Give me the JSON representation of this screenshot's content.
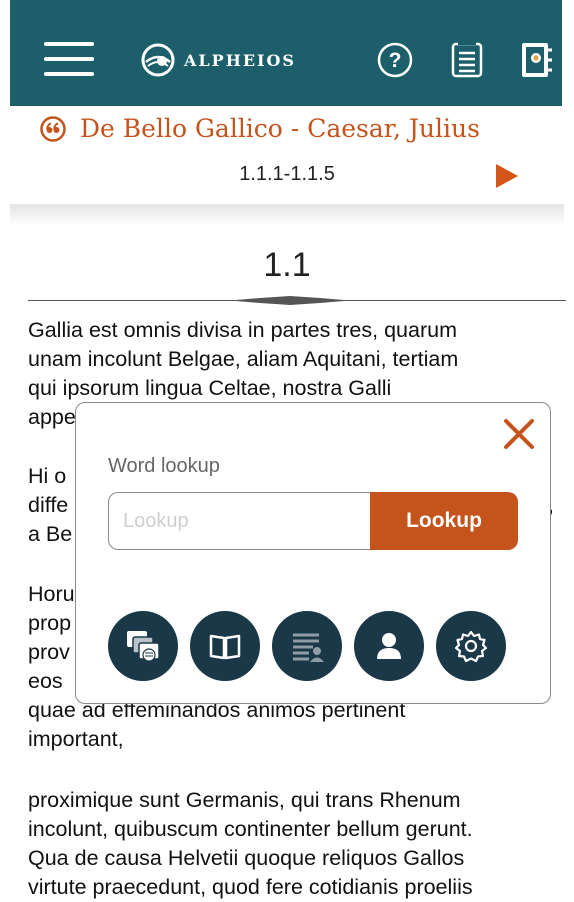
{
  "header": {
    "brand": "ALPHEIOS",
    "icons": [
      "menu-icon",
      "alpheios-logo",
      "help-icon",
      "list-icon",
      "notebook-icon"
    ]
  },
  "document": {
    "title": "De Bello Gallico - Caesar, Julius",
    "range": "1.1.1-1.1.5",
    "section": "1.1",
    "paragraphs": [
      {
        "lines": [
          "Gallia est omnis divisa in partes tres, quarum",
          "unam incolunt Belgae, aliam Aquitani, tertiam",
          "qui ipsorum lingua Celtae, nostra Galli",
          "appe"
        ]
      },
      {
        "lines": [
          "Hi o",
          "diffe",
          "a Be"
        ],
        "trailing_fragment": ","
      },
      {
        "lines": [
          "Horu",
          "prop",
          "prov",
          "eos",
          "quae ad effeminandos animos pertinent",
          "important,"
        ]
      },
      {
        "lines": [
          "proximique sunt Germanis, qui trans Rhenum",
          "incolunt, quibuscum continenter bellum gerunt.",
          "Qua de causa Helvetii quoque reliquos Gallos",
          "virtute praecedunt, quod fere cotidianis proeliis"
        ]
      }
    ]
  },
  "lookup_popup": {
    "label": "Word lookup",
    "placeholder": "Lookup",
    "value": "",
    "button_label": "Lookup",
    "tool_icons": [
      "inflections-icon",
      "dictionary-icon",
      "word-list-icon",
      "user-icon",
      "settings-icon"
    ]
  },
  "colors": {
    "header_bg": "#1c5f6a",
    "accent": "#c4541c",
    "tool_button_bg": "#1a3848"
  }
}
